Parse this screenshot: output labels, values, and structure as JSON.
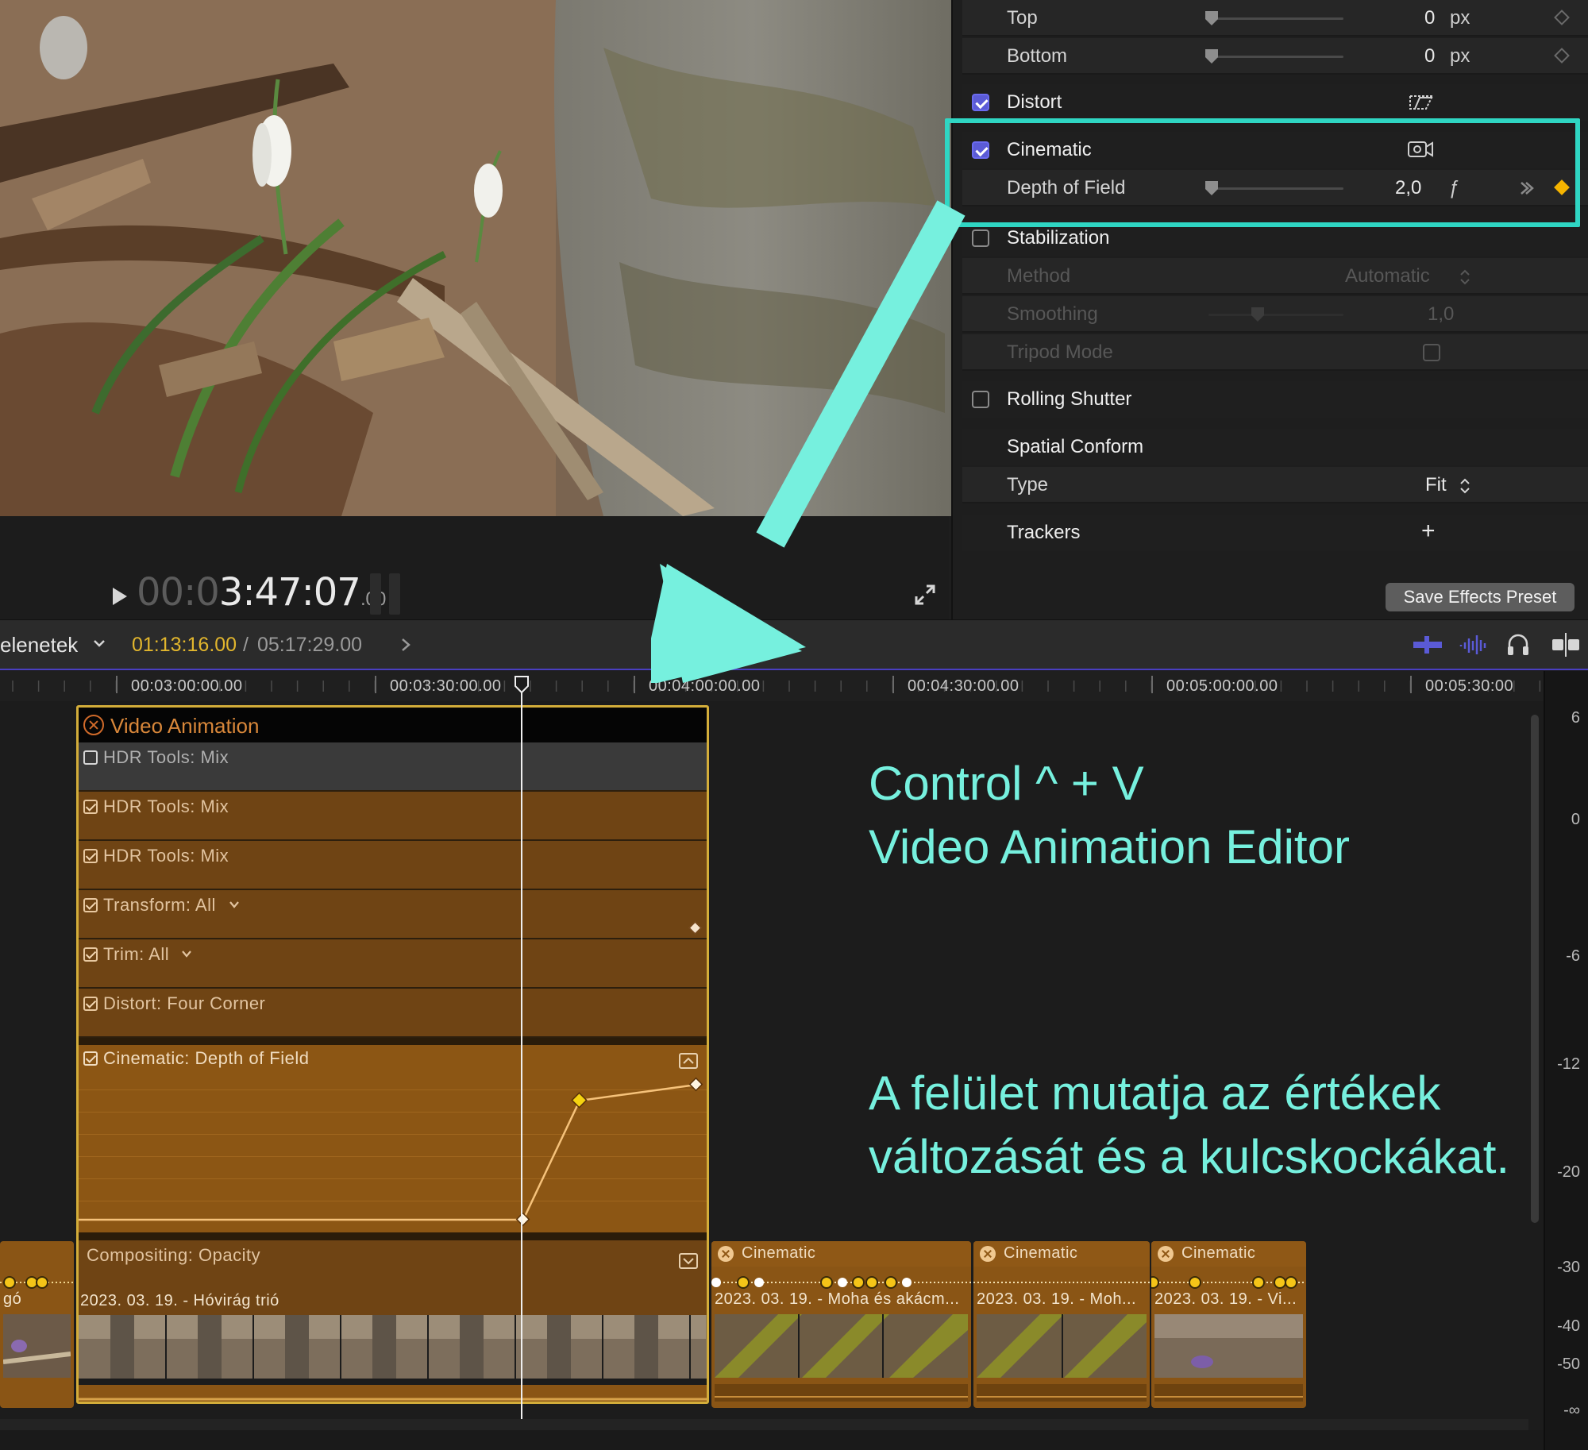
{
  "inspector": {
    "rows": {
      "top": {
        "label": "Top",
        "value": "0",
        "unit": "px"
      },
      "bottom": {
        "label": "Bottom",
        "value": "0",
        "unit": "px"
      },
      "distort": {
        "label": "Distort",
        "checked": true
      },
      "cinematic": {
        "label": "Cinematic",
        "checked": true
      },
      "depth_of_field": {
        "label": "Depth of Field",
        "value": "2,0",
        "unit": "ƒ"
      },
      "stabilization": {
        "label": "Stabilization",
        "checked": false
      },
      "method": {
        "label": "Method",
        "value": "Automatic"
      },
      "smoothing": {
        "label": "Smoothing",
        "value": "1,0"
      },
      "tripod_mode": {
        "label": "Tripod Mode",
        "checked": false
      },
      "rolling_shutter": {
        "label": "Rolling Shutter",
        "checked": false
      },
      "spatial_conform": {
        "label": "Spatial Conform"
      },
      "type": {
        "label": "Type",
        "value": "Fit"
      },
      "trackers": {
        "label": "Trackers",
        "add_symbol": "+"
      }
    },
    "save_preset_label": "Save Effects Preset"
  },
  "viewer": {
    "timecode_dim": "00:0",
    "timecode_bright": "3:47:07",
    "timecode_sub": ".00"
  },
  "timeline": {
    "project_name": "elenetek",
    "position": "01:13:16.00",
    "separator": "/",
    "duration": "05:17:29.00",
    "ruler_labels": [
      "00:03:00:00.00",
      "00:03:30:00.00",
      "00:04:00:00.00",
      "00:04:30:00.00",
      "00:05:00:00.00",
      "00:05:30:00"
    ],
    "animation_editor": {
      "title": "Video Animation",
      "lanes": [
        "HDR Tools: Mix",
        "HDR Tools: Mix",
        "HDR Tools: Mix",
        "Transform: All",
        "Trim: All",
        "Distort: Four Corner"
      ],
      "dof_lane": "Cinematic: Depth of Field",
      "compositing_lane": "Compositing: Opacity"
    },
    "clips": {
      "left_partial_title": "gó",
      "main_title": "2023. 03. 19. - Hóvirág trió",
      "c1_effect": "Cinematic",
      "c1_title": "2023. 03. 19. - Moha és akácm...",
      "c2_effect": "Cinematic",
      "c2_title": "2023. 03. 19. - Moh...",
      "c3_effect": "Cinematic",
      "c3_title": "2023. 03. 19. - Vi..."
    },
    "meter_labels": [
      "6",
      "0",
      "-6",
      "-12",
      "-20",
      "-30",
      "-40",
      "-50",
      "-∞"
    ]
  },
  "annotations": {
    "line1": "Control ^ + V",
    "line2": "Video Animation Editor",
    "line3": "A felület mutatja az értékek",
    "line4": "változását és a kulcskockákat."
  },
  "colors": {
    "highlight": "#2fd6c3",
    "annotation_text": "#76f0de",
    "keyframe_active": "#f5b400",
    "clip_orange": "#8a5515"
  }
}
